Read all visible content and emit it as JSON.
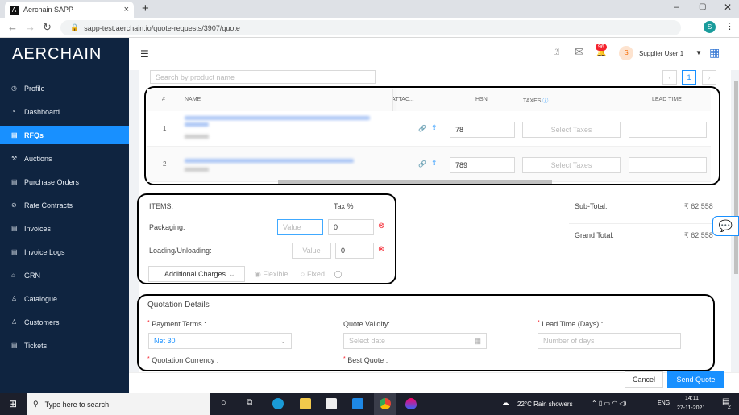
{
  "browser": {
    "tab_title": "Aerchain SAPP",
    "url": "sapp-test.aerchain.io/quote-requests/3907/quote"
  },
  "brand": {
    "logo": "AERCHAIN"
  },
  "sidebar": {
    "items": [
      {
        "label": "Profile",
        "icon": "clock-icon"
      },
      {
        "label": "Dashboard",
        "icon": "dashboard-icon"
      },
      {
        "label": "RFQs",
        "icon": "document-icon",
        "active": true
      },
      {
        "label": "Auctions",
        "icon": "gavel-icon"
      },
      {
        "label": "Purchase Orders",
        "icon": "order-icon"
      },
      {
        "label": "Rate Contracts",
        "icon": "contract-icon"
      },
      {
        "label": "Invoices",
        "icon": "invoice-icon"
      },
      {
        "label": "Invoice Logs",
        "icon": "log-icon"
      },
      {
        "label": "GRN",
        "icon": "bank-icon"
      },
      {
        "label": "Catalogue",
        "icon": "user-icon"
      },
      {
        "label": "Customers",
        "icon": "user-icon"
      },
      {
        "label": "Tickets",
        "icon": "ticket-icon"
      }
    ]
  },
  "header": {
    "notification_count": "96",
    "avatar_initial": "S",
    "user_name": "Supplier User 1"
  },
  "search": {
    "placeholder": "Search by product name"
  },
  "pagination": {
    "current": "1"
  },
  "table": {
    "headers": {
      "index": "#",
      "name": "NAME",
      "attachments": "ATTAC...",
      "hsn": "HSN",
      "taxes": "TAXES",
      "lead_time": "LEAD TIME"
    },
    "rows": [
      {
        "index": "1",
        "hsn": "78",
        "taxes_placeholder": "Select Taxes"
      },
      {
        "index": "2",
        "hsn": "789",
        "taxes_placeholder": "Select Taxes"
      }
    ]
  },
  "charges": {
    "items_label": "ITEMS:",
    "tax_label": "Tax %",
    "packaging_label": "Packaging:",
    "packaging_value_placeholder": "Value",
    "packaging_tax": "0",
    "loading_label": "Loading/Unloading:",
    "loading_value_placeholder": "Value",
    "loading_tax": "0",
    "additional_label": "Additional Charges",
    "flexible": "Flexible",
    "fixed": "Fixed"
  },
  "totals": {
    "subtotal_label": "Sub-Total:",
    "subtotal": "₹ 62,558",
    "grand_label": "Grand Total:",
    "grand": "₹ 62,558"
  },
  "quotation": {
    "title": "Quotation Details",
    "payment_terms_label": "Payment Terms :",
    "payment_terms_value": "Net 30",
    "validity_label": "Quote Validity:",
    "validity_placeholder": "Select date",
    "lead_label": "Lead Time (Days) :",
    "lead_placeholder": "Number of days",
    "currency_label": "Quotation Currency :",
    "best_quote_label": "Best Quote :"
  },
  "actions": {
    "cancel": "Cancel",
    "send": "Send Quote"
  },
  "taskbar": {
    "search_placeholder": "Type here to search",
    "weather": "22°C  Rain showers",
    "lang": "ENG",
    "time": "14:11",
    "date": "27-11-2021",
    "notif": "2"
  }
}
